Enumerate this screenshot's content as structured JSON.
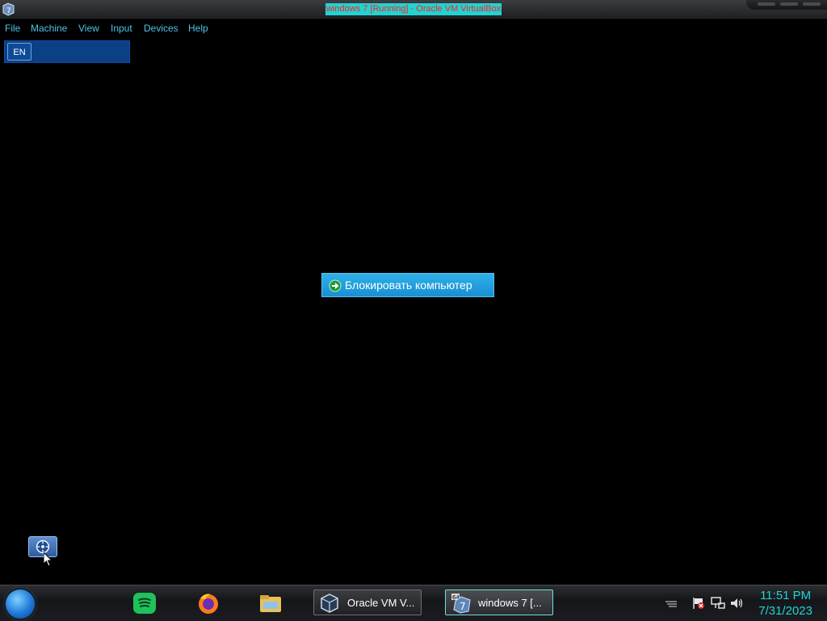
{
  "window": {
    "title": "windows 7 [Running] - Oracle VM VirtualBox",
    "app_icon": "virtualbox-vm-icon"
  },
  "menu": {
    "items": [
      "File",
      "Machine",
      "View",
      "Input",
      "Devices",
      "Help"
    ]
  },
  "language_bar": {
    "label": "EN"
  },
  "lock_button": {
    "label": "Блокировать компьютер",
    "icon": "arrow-right-icon"
  },
  "ease_of_access": {
    "icon": "ease-of-access-icon"
  },
  "taskbar": {
    "pinned": [
      "start-orb",
      "spotify-icon",
      "firefox-icon",
      "file-explorer-icon"
    ],
    "tasks": [
      {
        "label": "Oracle VM V...",
        "icon": "virtualbox-icon",
        "active": false
      },
      {
        "label": "windows 7 [...",
        "icon": "virtualbox-vm-icon",
        "active": true
      }
    ],
    "tray_icons": [
      "action-center-flag-icon",
      "network-icon",
      "volume-icon"
    ],
    "clock": {
      "time": "11:51 PM",
      "date": "7/31/2023"
    }
  },
  "colors": {
    "title_highlight": "#22d3d3",
    "title_text": "#ff1f1f",
    "menu_text": "#4fc3e8",
    "lock_button": "#1a8fd4",
    "clock_text": "#22d3d3"
  }
}
